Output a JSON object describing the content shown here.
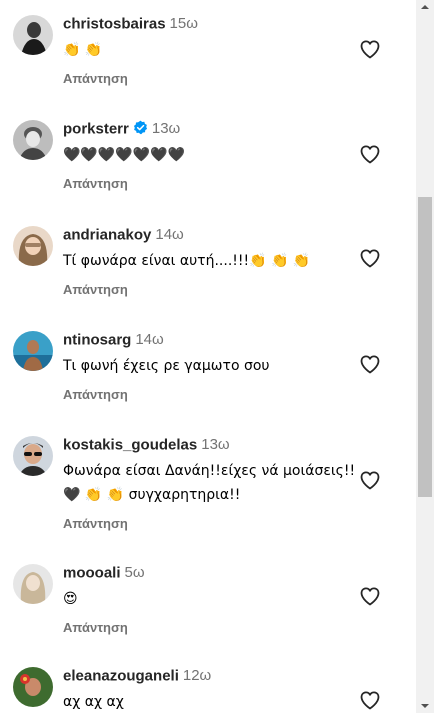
{
  "comments": [
    {
      "username": "christosbairas",
      "time": "15ω",
      "verified": false,
      "text": "👏 👏",
      "reply": "Απάντηση",
      "avatar_icon": "man-portrait-icon"
    },
    {
      "username": "porksterr",
      "time": "13ω",
      "verified": true,
      "text": "🖤🖤🖤🖤🖤🖤🖤",
      "reply": "Απάντηση",
      "avatar_icon": "man-portrait-icon"
    },
    {
      "username": "andrianakoy",
      "time": "14ω",
      "verified": false,
      "text": "Τί φωνάρα είναι αυτή....!!!👏 👏 👏",
      "reply": "Απάντηση",
      "avatar_icon": "woman-portrait-icon"
    },
    {
      "username": "ntinosarg",
      "time": "14ω",
      "verified": false,
      "text": "Τι φωνή έχεις ρε γαμωτο σου",
      "reply": "Απάντηση",
      "avatar_icon": "man-beach-icon"
    },
    {
      "username": "kostakis_goudelas",
      "time": "13ω",
      "verified": false,
      "text": "Φωνάρα είσαι Δανάη!!είχες νά μοιάσεις!!🖤 👏 👏 συγχαρητηρια!!",
      "reply": "Απάντηση",
      "avatar_icon": "man-sunglasses-icon"
    },
    {
      "username": "moooali",
      "time": "5ω",
      "verified": false,
      "text": "😍",
      "reply": "Απάντηση",
      "avatar_icon": "woman-portrait-icon"
    },
    {
      "username": "eleanazouganeli",
      "time": "12ω",
      "verified": false,
      "text": "αχ αχ αχ",
      "reply": "",
      "avatar_icon": "woman-flower-icon"
    }
  ],
  "icons": {
    "like": "heart-outline-icon",
    "verified": "verified-badge-icon"
  },
  "colors": {
    "username": "#262626",
    "secondary": "#737373",
    "verified": "#0095f6",
    "scroll_thumb": "#c1c1c1"
  }
}
